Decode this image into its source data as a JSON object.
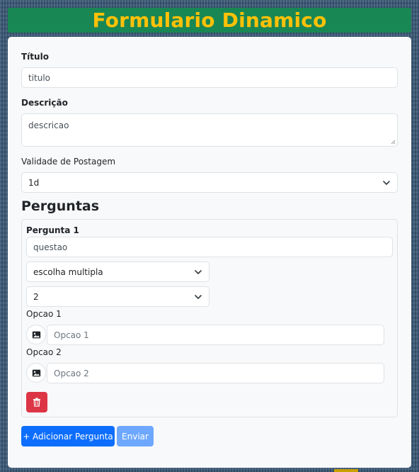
{
  "header": {
    "title": "Formulario Dinamico"
  },
  "form": {
    "title_label": "Título",
    "title_value": "titulo",
    "description_label": "Descrição",
    "description_value": "descricao",
    "validity_label": "Validade de Postagem",
    "validity_value": "1d"
  },
  "questions_heading": "Perguntas",
  "question": {
    "label": "Pergunta 1",
    "text": "questao",
    "type_value": "escolha multipla",
    "count_value": "2",
    "options": [
      {
        "label": "Opcao 1",
        "placeholder": "Opcao 1"
      },
      {
        "label": "Opcao 2",
        "placeholder": "Opcao 2"
      }
    ]
  },
  "actions": {
    "add_label": "+ Adicionar Pergunta",
    "submit_label": "Enviar"
  },
  "colors": {
    "header_bg": "#198754",
    "header_text": "#ffc107",
    "primary": "#0d6efd",
    "danger": "#dc3545"
  },
  "icons": {
    "select_chevron": "chevron-down-icon",
    "option_image": "image-icon",
    "delete": "trash-icon"
  }
}
